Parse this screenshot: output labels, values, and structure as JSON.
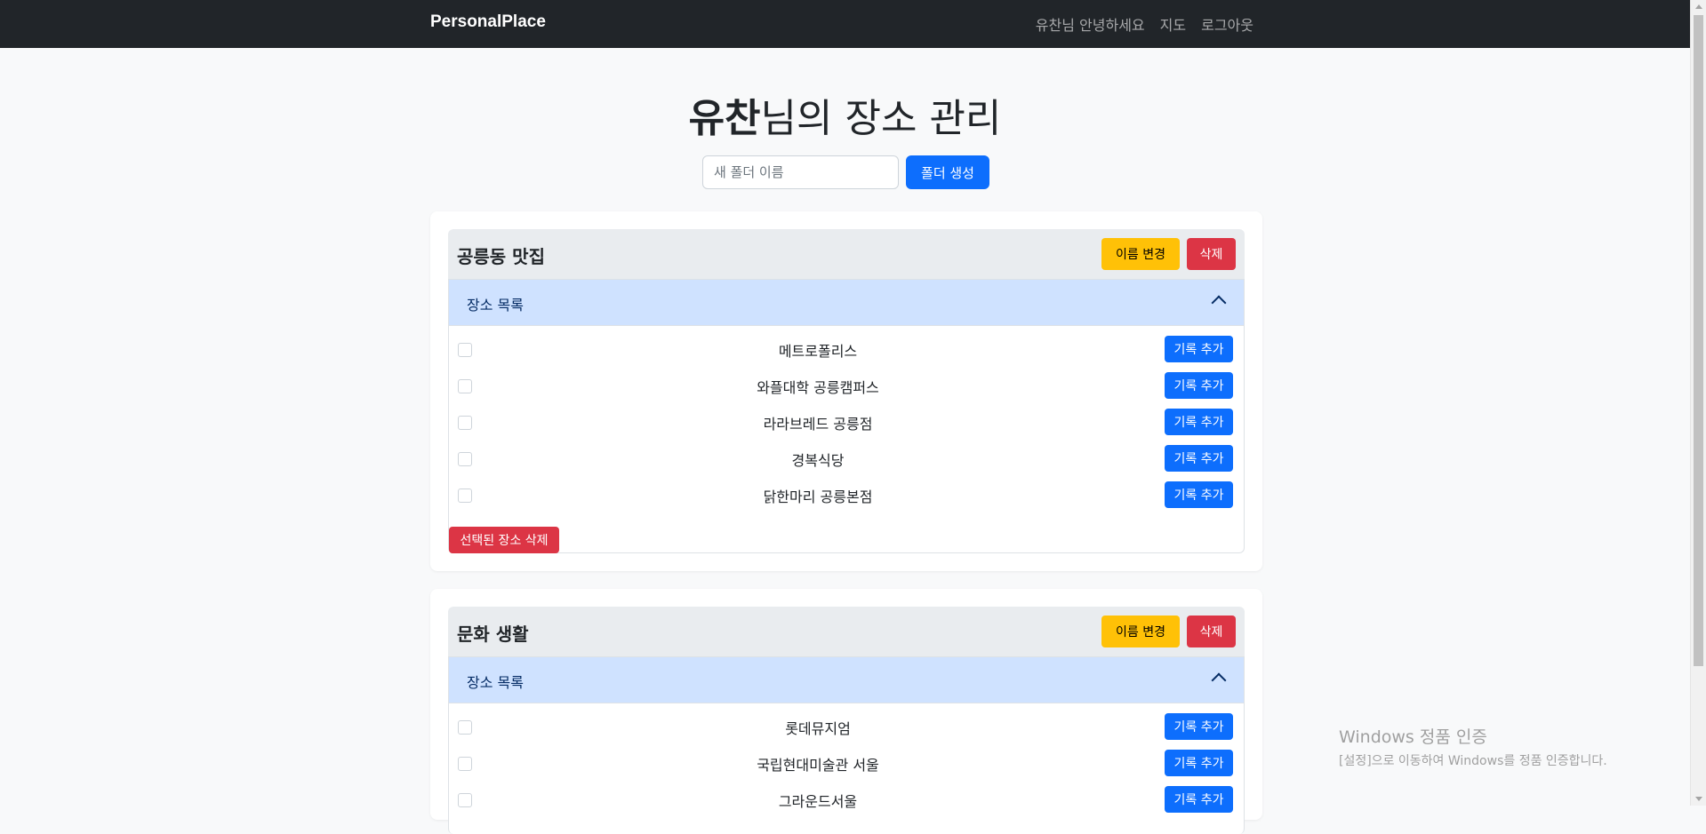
{
  "navbar": {
    "brand": "PersonalPlace",
    "links": [
      "유찬님 안녕하세요",
      "지도",
      "로그아웃"
    ]
  },
  "page_title": {
    "user": "유찬",
    "suffix": "님의 장소 관리"
  },
  "new_folder": {
    "placeholder": "새 폴더 이름",
    "button": "폴더 생성"
  },
  "folders": [
    {
      "name": "공릉동 맛집",
      "rename_label": "이름 변경",
      "delete_label": "삭제",
      "list_title": "장소 목록",
      "places": [
        "메트로폴리스",
        "와플대학 공릉캠퍼스",
        "라라브레드 공릉점",
        "경복식당",
        "닭한마리 공릉본점"
      ],
      "add_record_label": "기록 추가",
      "delete_selected_label": "선택된 장소 삭제"
    },
    {
      "name": "문화 생활",
      "rename_label": "이름 변경",
      "delete_label": "삭제",
      "list_title": "장소 목록",
      "places": [
        "롯데뮤지엄",
        "국립현대미술관 서울",
        "그라운드서울"
      ],
      "add_record_label": "기록 추가"
    }
  ],
  "watermark": {
    "title": "Windows 정품 인증",
    "subtitle": "[설정]으로 이동하여 Windows를 정품 인증합니다."
  }
}
